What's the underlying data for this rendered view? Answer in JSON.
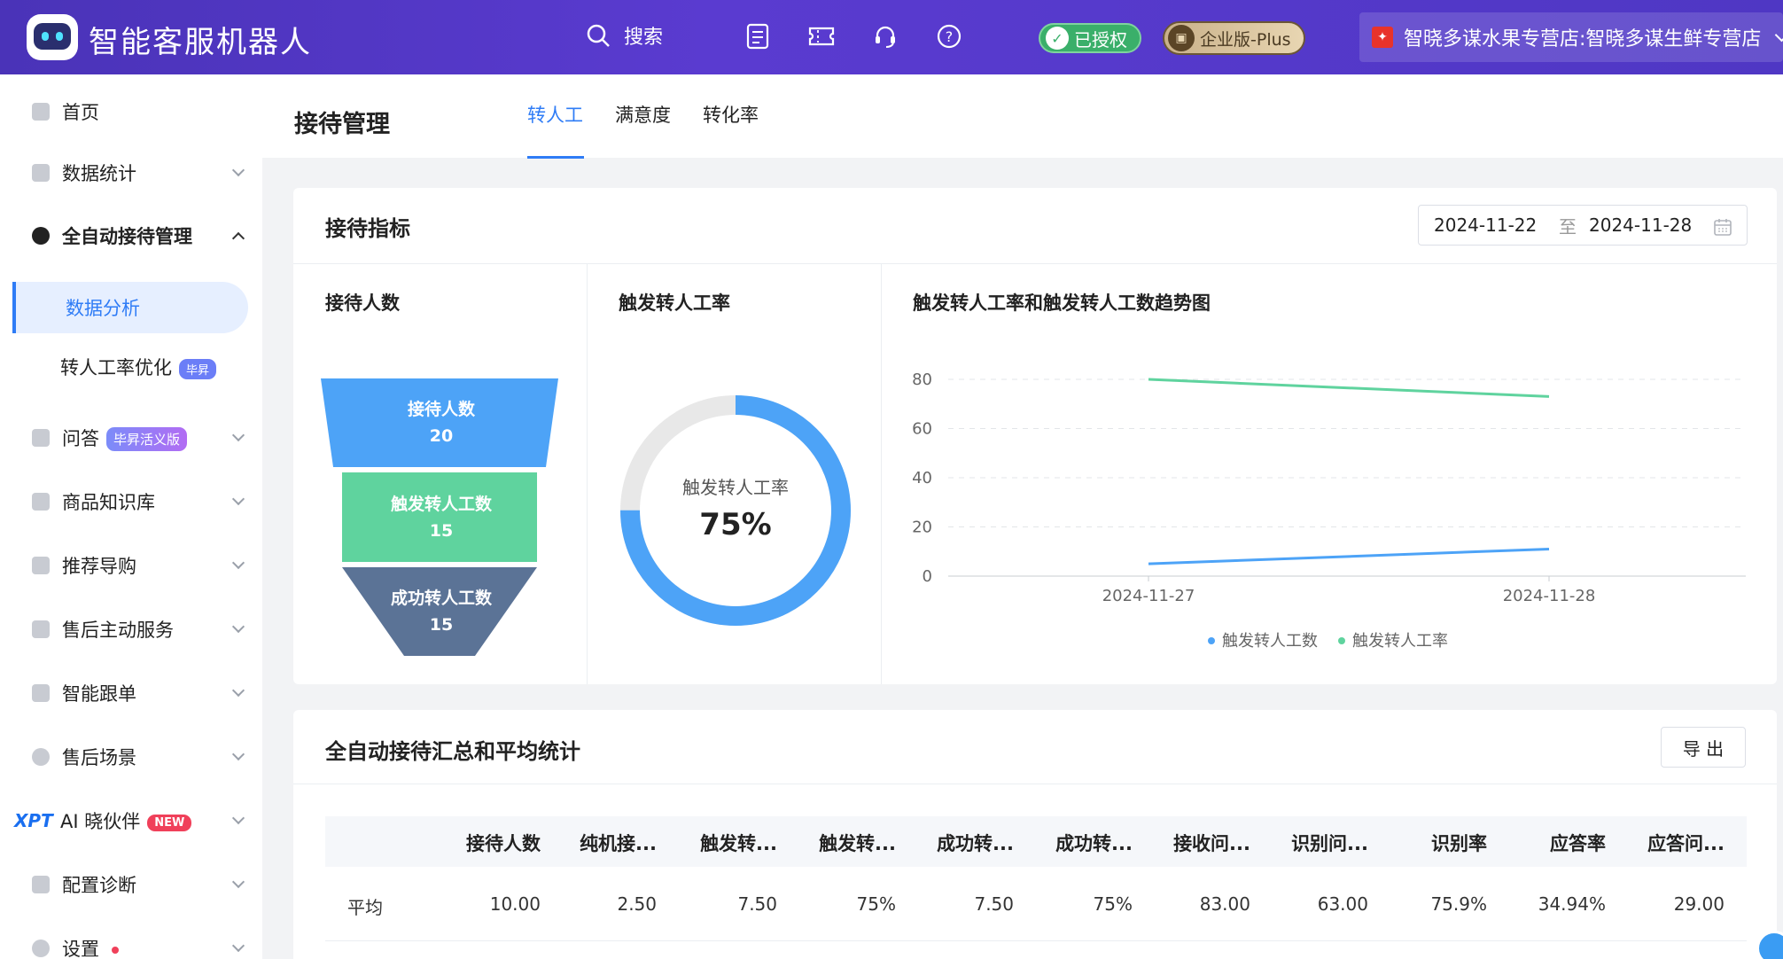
{
  "app": {
    "title": "智能客服机器人"
  },
  "topbar": {
    "search_label": "搜索",
    "authorized_label": "已授权",
    "edition_label": "企业版-Plus",
    "store_name": "智晓多谋水果专营店:智晓多谋生鲜专营店"
  },
  "sidebar": {
    "items": [
      {
        "label": "首页"
      },
      {
        "label": "数据统计"
      },
      {
        "label": "全自动接待管理"
      },
      {
        "label": "数据分析"
      },
      {
        "label": "转人工率优化",
        "tag": "毕昇"
      },
      {
        "label": "问答",
        "tag": "毕昇活义版"
      },
      {
        "label": "商品知识库"
      },
      {
        "label": "推荐导购"
      },
      {
        "label": "售后主动服务"
      },
      {
        "label": "智能跟单"
      },
      {
        "label": "售后场景"
      },
      {
        "label": "AI 晓伙伴",
        "prefix": "XPT",
        "tag": "NEW"
      },
      {
        "label": "配置诊断"
      },
      {
        "label": "设置"
      }
    ]
  },
  "page": {
    "title": "接待管理",
    "tabs": [
      "转人工",
      "满意度",
      "转化率"
    ]
  },
  "metrics_card": {
    "title": "接待指标",
    "date_start": "2024-11-22",
    "date_sep": "至",
    "date_end": "2024-11-28",
    "funnel_title": "接待人数",
    "funnel": [
      {
        "label": "接待人数",
        "value": "20",
        "color": "#4da3f7"
      },
      {
        "label": "触发转人工数",
        "value": "15",
        "color": "#5fd39e"
      },
      {
        "label": "成功转人工数",
        "value": "15",
        "color": "#5b7396"
      }
    ],
    "donut_title": "触发转人工率",
    "donut_label": "触发转人工率",
    "donut_value": "75%",
    "donut_fraction": 0.75,
    "trend_title": "触发转人工率和触发转人工数趋势图"
  },
  "chart_data": {
    "type": "line",
    "x": [
      "2024-11-27",
      "2024-11-28"
    ],
    "ylim": [
      0,
      80
    ],
    "yticks": [
      "80",
      "60",
      "40",
      "20",
      "0"
    ],
    "series": [
      {
        "name": "触发转人工数",
        "values": [
          5,
          11
        ],
        "color": "#4da3f7"
      },
      {
        "name": "触发转人工率",
        "values": [
          80,
          73
        ],
        "color": "#5fd39e"
      }
    ]
  },
  "summary_card": {
    "title": "全自动接待汇总和平均统计",
    "export_label": "导 出",
    "columns": [
      "接待人数",
      "纯机接...",
      "触发转...",
      "触发转...",
      "成功转...",
      "成功转...",
      "接收问...",
      "识别问...",
      "识别率",
      "应答率",
      "应答问..."
    ],
    "row_label": "平均",
    "row_values": [
      "10.00",
      "2.50",
      "7.50",
      "75%",
      "7.50",
      "75%",
      "83.00",
      "63.00",
      "75.9%",
      "34.94%",
      "29.00"
    ]
  }
}
